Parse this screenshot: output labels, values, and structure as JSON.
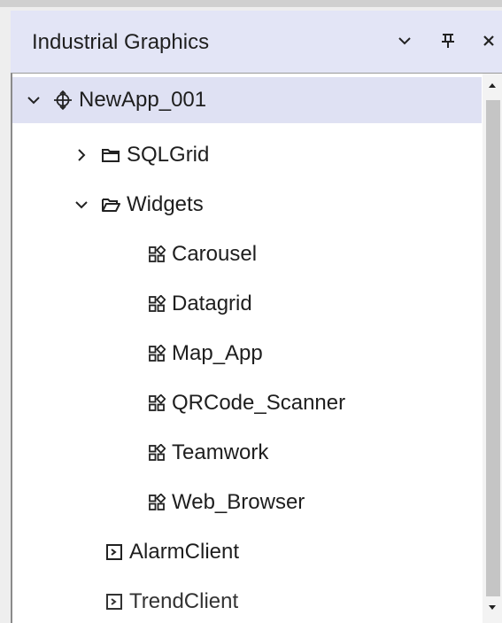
{
  "panel": {
    "title": "Industrial Graphics",
    "dropdown_icon": "chevron-down-icon",
    "pin_icon": "pin-icon",
    "close_icon": "close-icon"
  },
  "tree": {
    "root": {
      "label": "NewApp_001",
      "icon": "app-move-icon",
      "expanded": true,
      "selected": true
    },
    "sqlgrid": {
      "label": "SQLGrid",
      "icon": "folder-closed-icon",
      "expanded": false
    },
    "widgets": {
      "label": "Widgets",
      "icon": "folder-open-icon",
      "expanded": true
    },
    "widget_items": [
      {
        "label": "Carousel",
        "icon": "widget-grid-icon"
      },
      {
        "label": "Datagrid",
        "icon": "widget-grid-icon"
      },
      {
        "label": "Map_App",
        "icon": "widget-grid-icon"
      },
      {
        "label": "QRCode_Scanner",
        "icon": "widget-grid-icon"
      },
      {
        "label": "Teamwork",
        "icon": "widget-grid-icon"
      },
      {
        "label": "Web_Browser",
        "icon": "widget-grid-icon"
      }
    ],
    "clients": [
      {
        "label": "AlarmClient",
        "icon": "client-control-icon"
      },
      {
        "label": "TrendClient",
        "icon": "client-control-icon"
      }
    ]
  },
  "colors": {
    "header_bg": "#e3e5f6",
    "selected_row_bg": "#dfe1f3",
    "scroll_thumb": "#c5c5c5"
  }
}
